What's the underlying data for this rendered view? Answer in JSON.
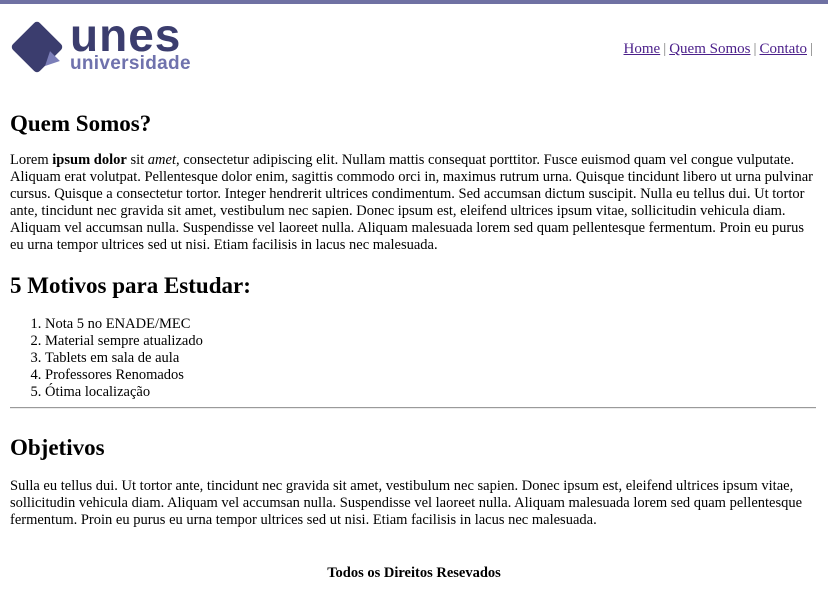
{
  "brand": {
    "name": "unes",
    "subtitle": "universidade",
    "colors": {
      "primary": "#3b3d6e",
      "secondary": "#6f72ad",
      "topbar": "#6f71a3",
      "link": "#4b1f8a"
    }
  },
  "nav": {
    "items": [
      {
        "label": "Home"
      },
      {
        "label": "Quem Somos"
      },
      {
        "label": "Contato"
      }
    ],
    "separator": "|"
  },
  "sections": {
    "quem_somos": {
      "title": "Quem Somos?",
      "lead_word": "Lorem ",
      "bold": "ipsum dolor",
      "mid": " sit ",
      "italic": "amet",
      "rest": ", consectetur adipiscing elit. Nullam mattis consequat porttitor. Fusce euismod quam vel congue vulputate. Aliquam erat volutpat. Pellentesque dolor enim, sagittis commodo orci in, maximus rutrum urna. Quisque tincidunt libero ut urna pulvinar cursus. Quisque a consectetur tortor. Integer hendrerit ultrices condimentum. Sed accumsan dictum suscipit. Nulla eu tellus dui. Ut tortor ante, tincidunt nec gravida sit amet, vestibulum nec sapien. Donec ipsum est, eleifend ultrices ipsum vitae, sollicitudin vehicula diam. Aliquam vel accumsan nulla. Suspendisse vel laoreet nulla. Aliquam malesuada lorem sed quam pellentesque fermentum. Proin eu purus eu urna tempor ultrices sed ut nisi. Etiam facilisis in lacus nec malesuada."
    },
    "motivos": {
      "title": "5 Motivos para Estudar:",
      "items": [
        "Nota 5 no ENADE/MEC",
        "Material sempre atualizado",
        "Tablets em sala de aula",
        "Professores Renomados",
        "Ótima localização"
      ]
    },
    "objetivos": {
      "title": "Objetivos",
      "text": "Sulla eu tellus dui. Ut tortor ante, tincidunt nec gravida sit amet, vestibulum nec sapien. Donec ipsum est, eleifend ultrices ipsum vitae, sollicitudin vehicula diam. Aliquam vel accumsan nulla. Suspendisse vel laoreet nulla. Aliquam malesuada lorem sed quam pellentesque fermentum. Proin eu purus eu urna tempor ultrices sed ut nisi. Etiam facilisis in lacus nec malesuada."
    }
  },
  "footer": {
    "text": "Todos os Direitos Resevados"
  }
}
